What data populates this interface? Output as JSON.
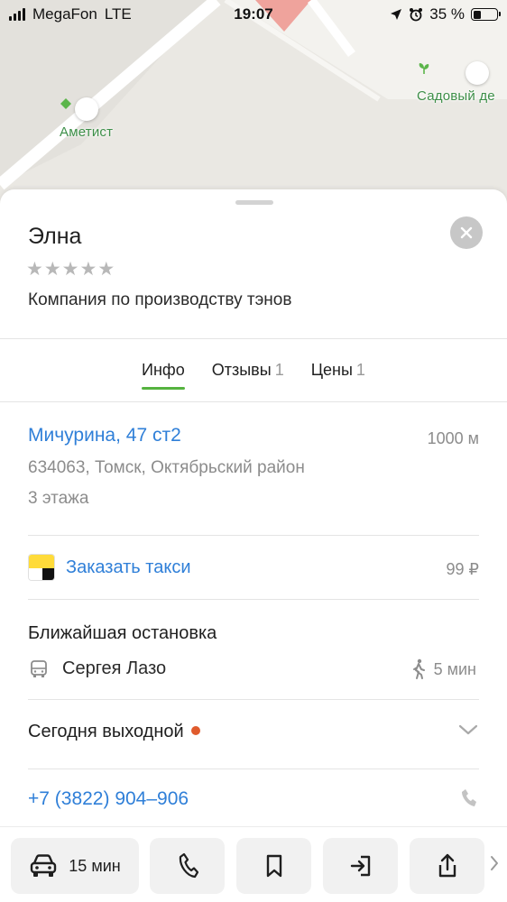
{
  "status_bar": {
    "carrier": "MegaFon",
    "network": "LTE",
    "time": "19:07",
    "battery": "35 %",
    "battery_level": 0.35
  },
  "map": {
    "pois": [
      {
        "name": "Аметист",
        "icon": "diamond-pin-icon",
        "color": "#5bb54a"
      },
      {
        "name": "Садовый де",
        "icon": "leaf-pin-icon",
        "color": "#5bb54a"
      }
    ]
  },
  "card": {
    "title": "Элна",
    "rating_stars": [
      "★",
      "★",
      "★",
      "★",
      "★"
    ],
    "rating_value": 0,
    "category": "Компания по производству тэнов",
    "tabs": [
      {
        "label": "Инфо",
        "count": ""
      },
      {
        "label": "Отзывы",
        "count": "1"
      },
      {
        "label": "Цены",
        "count": "1"
      }
    ],
    "address": {
      "street": "Мичурина, 47 ст2",
      "distance": "1000 м",
      "city": "634063, Томск, Октябрьский район",
      "floors": "3 этажа"
    },
    "taxi": {
      "label": "Заказать такси",
      "price": "99 ₽"
    },
    "nearest_stop": {
      "title": "Ближайшая остановка",
      "name": "Сергея Лазо",
      "walk_time": "5 мин"
    },
    "hours": {
      "label": "Сегодня выходной",
      "status_color": "#e05b2d"
    },
    "phone": "+7 (3822) 904–906"
  },
  "actions": {
    "route_time": "15 мин",
    "icons": [
      "car-icon",
      "phone-icon",
      "bookmark-icon",
      "exit-icon",
      "share-icon",
      "chevron-right-icon"
    ]
  },
  "colors": {
    "accent_link": "#2f7fd8",
    "tab_underline": "#55b33f",
    "poi_green": "#3d8f48"
  }
}
